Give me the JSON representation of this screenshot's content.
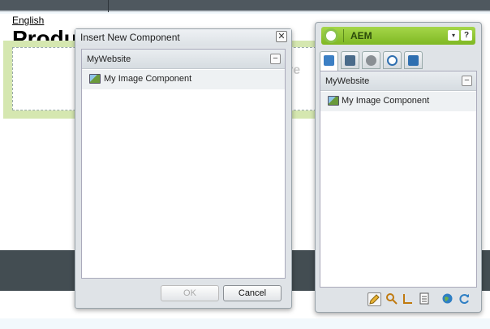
{
  "page": {
    "lang_link": "English",
    "title": "Produc",
    "ghost_text": "re"
  },
  "dialog": {
    "title": "Insert New Component",
    "close_glyph": "✕",
    "group": {
      "label": "MyWebsite",
      "collapse_glyph": "−"
    },
    "items": [
      {
        "label": "My Image Component",
        "icon": "image-component-icon"
      }
    ],
    "buttons": {
      "ok": "OK",
      "cancel": "Cancel"
    }
  },
  "sidekick": {
    "title": "AEM",
    "menu_glyph": "▾",
    "help_glyph": "?",
    "tabs": [
      {
        "icon": "components-tab-icon",
        "color": "#3b7fc4"
      },
      {
        "icon": "page-tab-icon",
        "color": "#4a6b8a"
      },
      {
        "icon": "lock-tab-icon",
        "color": "#8a8f94"
      },
      {
        "icon": "versioning-tab-icon",
        "color": "#2f6fb0"
      },
      {
        "icon": "workflow-tab-icon",
        "color": "#2f6fb0"
      }
    ],
    "group": {
      "label": "MyWebsite",
      "collapse_glyph": "−"
    },
    "items": [
      {
        "label": "My Image Component",
        "icon": "image-component-icon"
      }
    ],
    "toolbar": [
      {
        "icon": "edit-mode-icon",
        "glyph": "✎",
        "color": "#d49a1a"
      },
      {
        "icon": "preview-mode-icon",
        "glyph": "⚲",
        "color": "#c07a10"
      },
      {
        "icon": "design-mode-icon",
        "glyph": "∟",
        "color": "#c07a10"
      },
      {
        "icon": "page-properties-icon",
        "glyph": "▤",
        "color": "#555"
      },
      {
        "icon": "globe-icon",
        "glyph": "●",
        "color": "#2f7fc4"
      },
      {
        "icon": "refresh-icon",
        "glyph": "⟳",
        "color": "#2f7fc4"
      }
    ]
  },
  "colors": {
    "sidekick_header": "#8fc73a",
    "page_region": "#d5e7b0",
    "footer_bar": "#434d52"
  }
}
